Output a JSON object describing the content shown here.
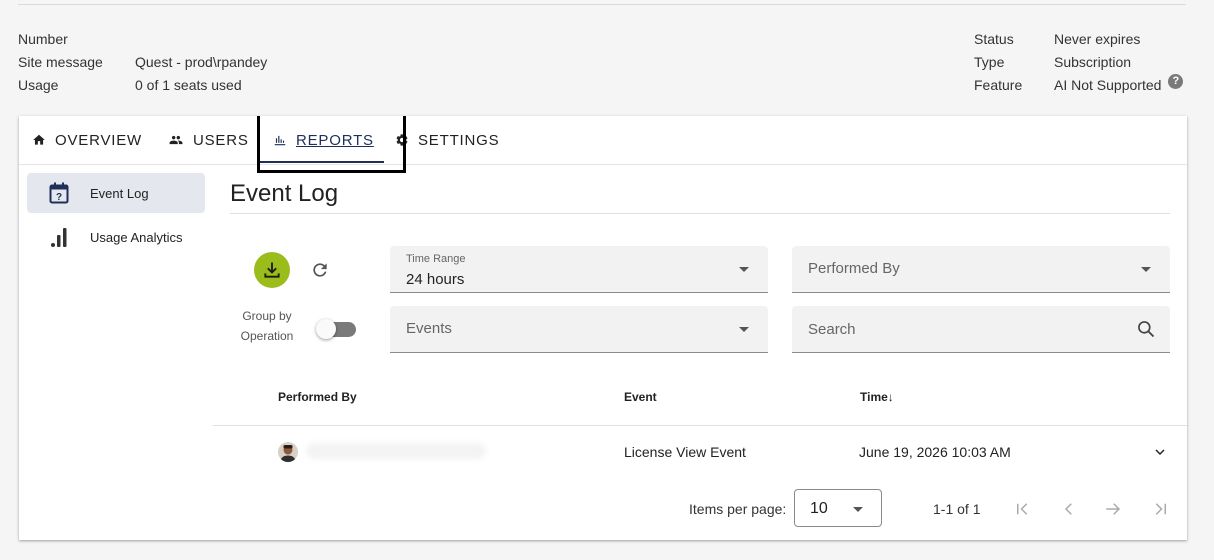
{
  "license_info": {
    "left": [
      {
        "key": "Number",
        "value": ""
      },
      {
        "key": "Site message",
        "value": "Quest - prod\\rpandey"
      },
      {
        "key": "Usage",
        "value": "0 of 1 seats used"
      }
    ],
    "right": [
      {
        "key": "Status",
        "value": "Never expires"
      },
      {
        "key": "Type",
        "value": "Subscription"
      },
      {
        "key": "Feature",
        "value": "AI Not Supported"
      }
    ],
    "help_glyph": "?"
  },
  "tabs": [
    {
      "label": "OVERVIEW",
      "icon": "home-icon"
    },
    {
      "label": "USERS",
      "icon": "users-icon"
    },
    {
      "label": "REPORTS",
      "icon": "reports-icon",
      "active": true
    },
    {
      "label": "SETTINGS",
      "icon": "gear-icon"
    }
  ],
  "sidebar": {
    "items": [
      {
        "label": "Event Log",
        "icon": "calendar-icon",
        "active": true
      },
      {
        "label": "Usage Analytics",
        "icon": "bar-chart-icon"
      }
    ]
  },
  "page": {
    "title": "Event Log"
  },
  "filters": {
    "group_by_label": "Group by Operation",
    "group_by_enabled": false,
    "time_range": {
      "label": "Time Range",
      "value": "24 hours"
    },
    "performed_by": {
      "placeholder": "Performed By"
    },
    "events": {
      "placeholder": "Events"
    },
    "search": {
      "placeholder": "Search"
    }
  },
  "table": {
    "headers": {
      "performed_by": "Performed By",
      "event": "Event",
      "time": "Time"
    },
    "sort_indicator": "↓",
    "rows": [
      {
        "performed_by": "",
        "event": "License View Event",
        "time": "June 19, 2026 10:03 AM"
      }
    ]
  },
  "pagination": {
    "items_per_page_label": "Items per page:",
    "items_per_page": "10",
    "range": "1-1 of 1"
  },
  "colors": {
    "accent": "#1f2f5a",
    "download": "#9bbd1b",
    "active_side": "#e4e7ee"
  }
}
